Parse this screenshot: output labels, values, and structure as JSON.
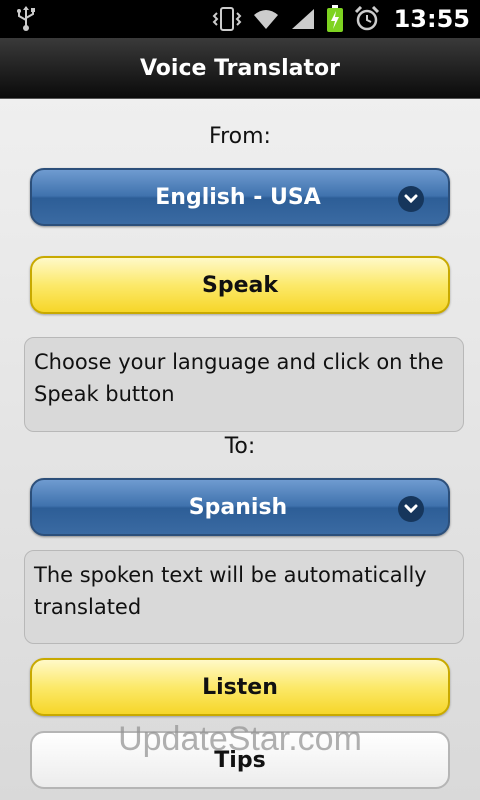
{
  "status_bar": {
    "time": "13:55",
    "icons": [
      "usb-icon",
      "vibrate-icon",
      "wifi-icon",
      "signal-icon",
      "battery-charging-icon",
      "alarm-icon"
    ]
  },
  "app": {
    "title": "Voice Translator"
  },
  "from": {
    "label": "From:",
    "selected_language": "English - USA",
    "speak_label": "Speak",
    "source_text": "Choose your language and click on the Speak button"
  },
  "to": {
    "label": "To:",
    "selected_language": "Spanish",
    "translated_text": "The spoken text will be automatically translated",
    "listen_label": "Listen"
  },
  "tips_label": "Tips",
  "watermark": "UpdateStar.com",
  "colors": {
    "select_blue": "#3f72ad",
    "button_yellow": "#fce96a",
    "title_bar": "#1a1a1a"
  }
}
